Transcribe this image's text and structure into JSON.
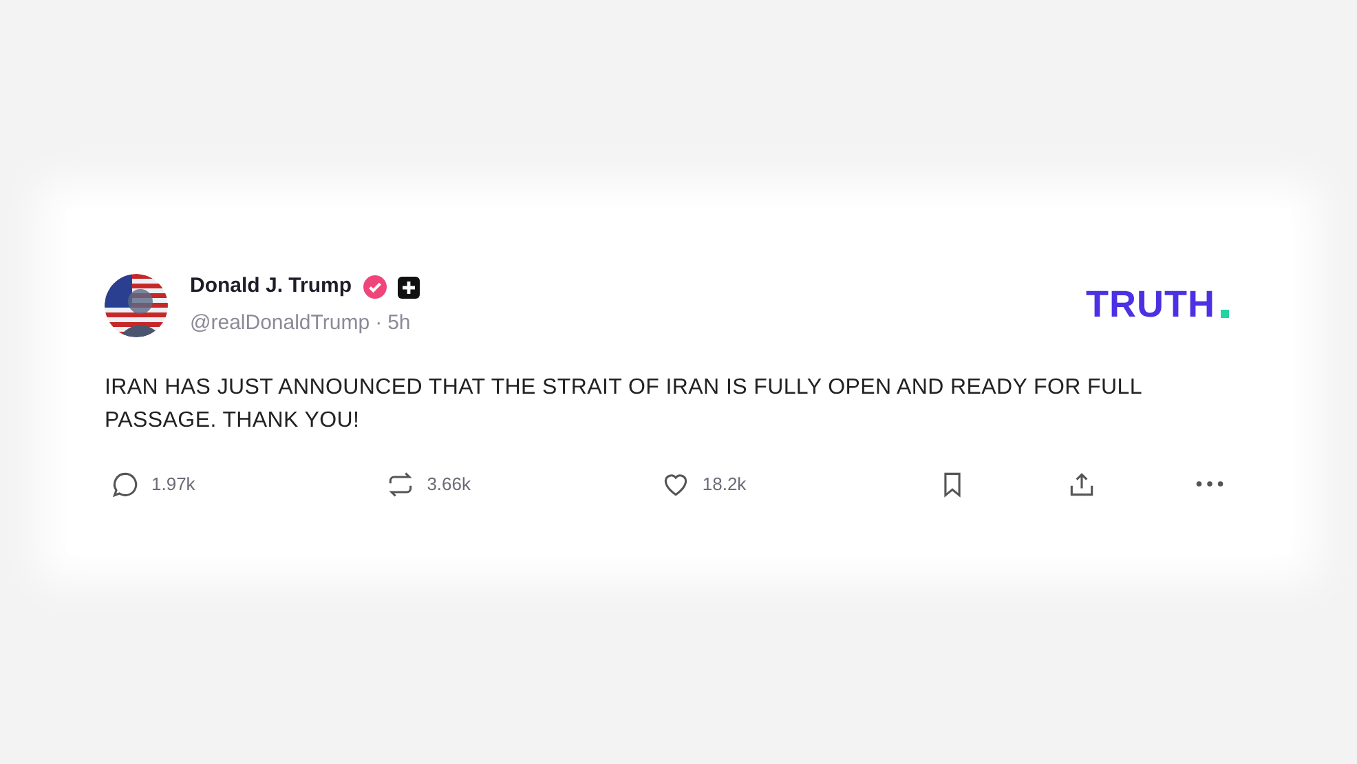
{
  "post": {
    "author": "Donald J. Trump",
    "verified": true,
    "handle": "@realDonaldTrump",
    "separator": "·",
    "time": "5h",
    "logo": "TRUTH",
    "body": "IRAN HAS JUST ANNOUNCED THAT THE STRAIT OF IRAN IS FULLY OPEN AND READY FOR FULL PASSAGE. THANK YOU!",
    "actions": [
      {
        "kind": "reply",
        "count": "1.97k"
      },
      {
        "kind": "repost",
        "count": "3.66k"
      },
      {
        "kind": "like",
        "count": "18.2k"
      },
      {
        "kind": "bookmark"
      },
      {
        "kind": "share"
      },
      {
        "kind": "more"
      }
    ]
  }
}
